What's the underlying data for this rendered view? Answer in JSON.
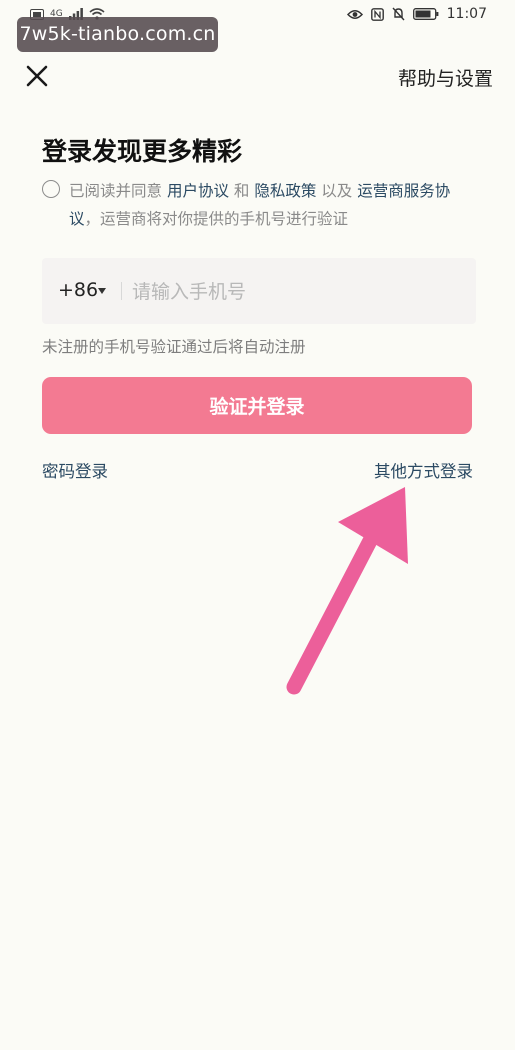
{
  "status_bar": {
    "network": "4G",
    "time": "11:07",
    "icons": [
      "sim-icon",
      "signal-icon",
      "wifi-icon",
      "eye-icon",
      "nfc-icon",
      "mute-icon",
      "battery-icon"
    ]
  },
  "watermark": "7w5k-tianbo.com.cn",
  "header": {
    "close_icon": "close-icon",
    "help_label": "帮助与设置"
  },
  "login": {
    "title": "登录发现更多精彩",
    "agreement": {
      "prefix": "已阅读并同意 ",
      "user_agreement": "用户协议",
      "and": " 和 ",
      "privacy_policy": "隐私政策",
      "also": " 以及 ",
      "carrier_service": "运营商服务协议",
      "suffix": "，运营商将对你提供的手机号进行验证"
    },
    "country_code": "+86",
    "phone_placeholder": "请输入手机号",
    "phone_value": "",
    "hint": "未注册的手机号验证通过后将自动注册",
    "submit_label": "验证并登录",
    "password_login": "密码登录",
    "other_login": "其他方式登录"
  },
  "colors": {
    "primary_button": "#f37a92",
    "link": "#2b4a63",
    "annotation_arrow": "#ec5f9a",
    "background": "#fbfbf6"
  }
}
